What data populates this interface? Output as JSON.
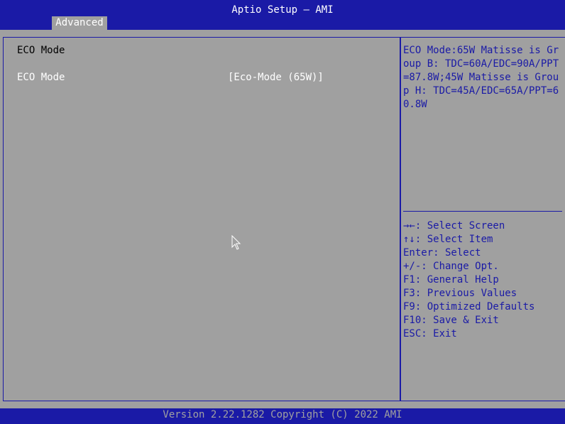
{
  "header": {
    "title": "Aptio Setup – AMI",
    "tabs": [
      {
        "label": "Advanced",
        "active": true
      }
    ]
  },
  "main": {
    "section_title": "ECO Mode",
    "settings": [
      {
        "label": "ECO Mode",
        "value": "[Eco-Mode (65W)]"
      }
    ]
  },
  "help": {
    "description": "ECO Mode:65W Matisse is Group B: TDC=60A/EDC=90A/PPT=87.8W;45W Matisse is Group H: TDC=45A/EDC=65A/PPT=60.8W",
    "keys": [
      "→←: Select Screen",
      "↑↓: Select Item",
      "Enter: Select",
      "+/-: Change Opt.",
      "F1: General Help",
      "F3: Previous Values",
      "F9: Optimized Defaults",
      "F10: Save & Exit",
      "ESC: Exit"
    ]
  },
  "footer": {
    "version": "Version 2.22.1282 Copyright (C) 2022 AMI"
  },
  "colors": {
    "bar_blue": "#1a1aa6",
    "background_gray": "#a0a0a0",
    "text_white": "#ffffff"
  },
  "icons": {
    "pointer": "mouse-pointer-icon"
  }
}
